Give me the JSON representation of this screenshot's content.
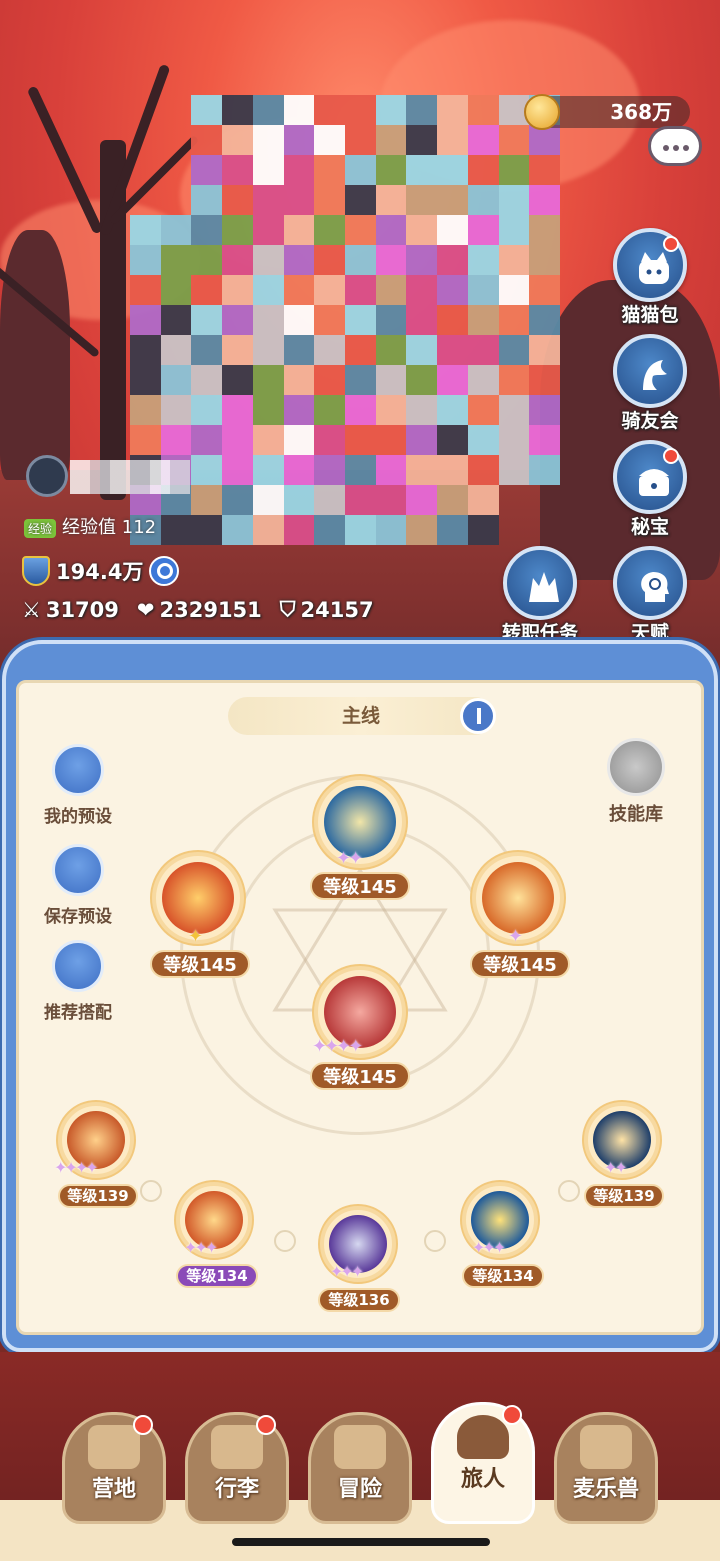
{
  "currency": {
    "amount": "368万",
    "icon": "coin-icon"
  },
  "chat": {
    "icon": "chat-bubble-icon"
  },
  "side_menu": [
    {
      "label": "猫猫包",
      "icon": "cat-bag-icon",
      "badge": true
    },
    {
      "label": "骑友会",
      "icon": "horse-icon",
      "badge": false
    },
    {
      "label": "秘宝",
      "icon": "treasure-icon",
      "badge": true
    },
    {
      "label": "天赋",
      "icon": "talent-head-icon",
      "badge": false
    },
    {
      "label": "转职任务",
      "icon": "class-change-icon",
      "badge": false
    }
  ],
  "player": {
    "exp_tag": "经验",
    "exp_value": "经验值 112",
    "power": "194.4万",
    "attack": "31709",
    "hp": "2329151",
    "defense": "24157"
  },
  "panel": {
    "title": "主线",
    "left_buttons": [
      "我的预设",
      "保存预设",
      "推荐搭配"
    ],
    "skill_library": "技能库"
  },
  "skills": [
    {
      "level": "等级145",
      "stars": 2
    },
    {
      "level": "等级145",
      "stars": 1
    },
    {
      "level": "等级145",
      "stars": 1
    },
    {
      "level": "等级145",
      "stars": 4
    },
    {
      "level": "等级139",
      "stars": 4
    },
    {
      "level": "等级139",
      "stars": 2
    },
    {
      "level": "等级134",
      "stars": 3
    },
    {
      "level": "等级134",
      "stars": 3
    },
    {
      "level": "等级136",
      "stars": 3
    }
  ],
  "nav": [
    {
      "label": "营地",
      "icon": "castle-icon",
      "badge": true,
      "active": false
    },
    {
      "label": "行李",
      "icon": "backpack-icon",
      "badge": true,
      "active": false
    },
    {
      "label": "冒险",
      "icon": "crossed-swords-icon",
      "badge": false,
      "active": false
    },
    {
      "label": "旅人",
      "icon": "traveler-avatar-icon",
      "badge": true,
      "active": true
    },
    {
      "label": "麦乐兽",
      "icon": "cat-face-icon",
      "badge": false,
      "active": false
    }
  ],
  "colors": {
    "panel_bg": "#fbf3e2",
    "frame_blue": "#5e8fd6",
    "level_badge": "#a05a28",
    "badge_red": "#f04a3a"
  }
}
